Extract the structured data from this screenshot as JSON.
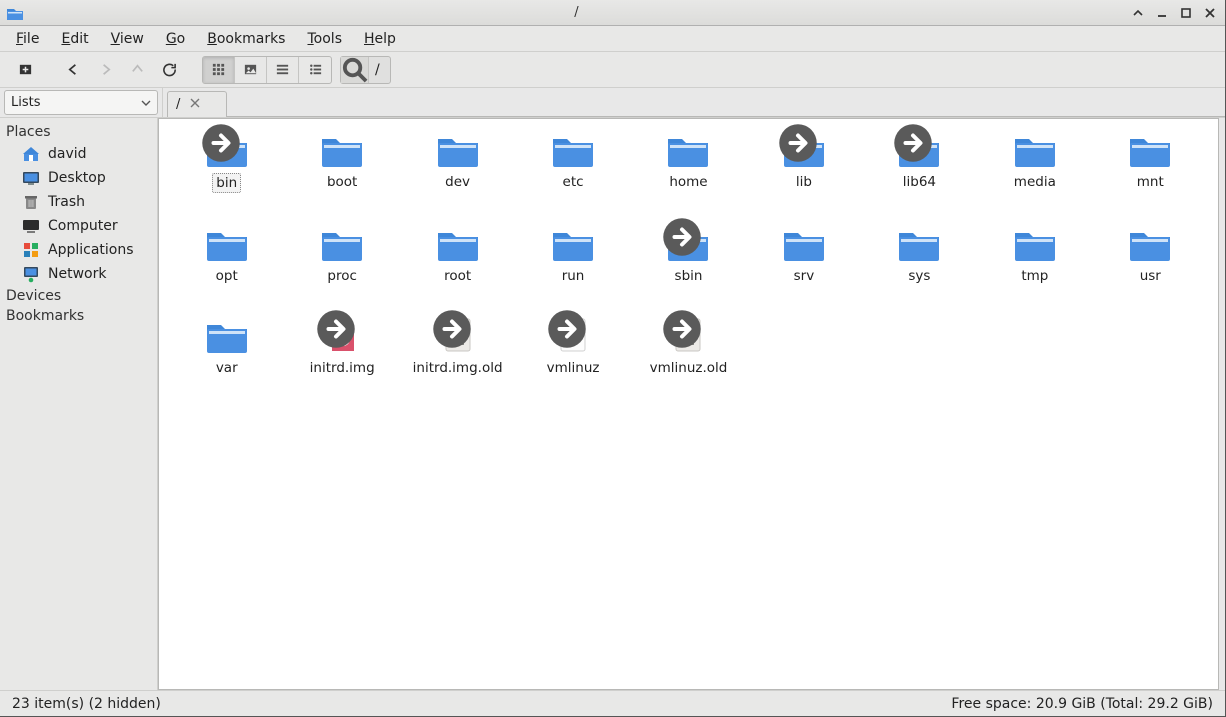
{
  "window": {
    "title": "/"
  },
  "menu": {
    "file": "File",
    "edit": "Edit",
    "view": "View",
    "go": "Go",
    "bookmarks": "Bookmarks",
    "tools": "Tools",
    "help": "Help"
  },
  "path": {
    "label": "/"
  },
  "sidebar": {
    "combo": "Lists",
    "places_header": "Places",
    "devices_header": "Devices",
    "bookmarks_header": "Bookmarks",
    "items": [
      {
        "icon": "home",
        "label": "david"
      },
      {
        "icon": "desktop",
        "label": "Desktop"
      },
      {
        "icon": "trash",
        "label": "Trash"
      },
      {
        "icon": "computer",
        "label": "Computer"
      },
      {
        "icon": "apps",
        "label": "Applications"
      },
      {
        "icon": "network",
        "label": "Network"
      }
    ]
  },
  "tab": {
    "label": "/"
  },
  "items": [
    {
      "name": "bin",
      "type": "folder",
      "link": true,
      "selected": true
    },
    {
      "name": "boot",
      "type": "folder"
    },
    {
      "name": "dev",
      "type": "folder"
    },
    {
      "name": "etc",
      "type": "folder"
    },
    {
      "name": "home",
      "type": "folder"
    },
    {
      "name": "lib",
      "type": "folder",
      "link": true
    },
    {
      "name": "lib64",
      "type": "folder",
      "link": true
    },
    {
      "name": "media",
      "type": "folder"
    },
    {
      "name": "mnt",
      "type": "folder"
    },
    {
      "name": "opt",
      "type": "folder"
    },
    {
      "name": "proc",
      "type": "folder"
    },
    {
      "name": "root",
      "type": "folder"
    },
    {
      "name": "run",
      "type": "folder"
    },
    {
      "name": "sbin",
      "type": "folder",
      "link": true
    },
    {
      "name": "srv",
      "type": "folder"
    },
    {
      "name": "sys",
      "type": "folder"
    },
    {
      "name": "tmp",
      "type": "folder"
    },
    {
      "name": "usr",
      "type": "folder"
    },
    {
      "name": "var",
      "type": "folder"
    },
    {
      "name": "initrd.img",
      "type": "disc",
      "link": true
    },
    {
      "name": "initrd.img.old",
      "type": "file",
      "link": true
    },
    {
      "name": "vmlinuz",
      "type": "win",
      "link": true
    },
    {
      "name": "vmlinuz.old",
      "type": "file",
      "link": true
    }
  ],
  "status": {
    "left": "23 item(s) (2 hidden)",
    "right": "Free space: 20.9 GiB (Total: 29.2 GiB)"
  }
}
